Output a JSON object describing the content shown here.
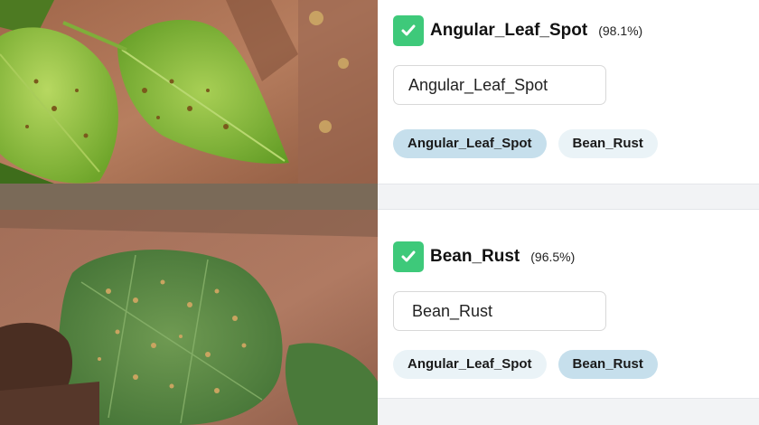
{
  "results": [
    {
      "title": "Angular_Leaf_Spot",
      "confidence": "(98.1%)",
      "input_value": "Angular_Leaf_Spot",
      "tags": [
        "Angular_Leaf_Spot",
        "Bean_Rust"
      ],
      "selected_tag": 0,
      "image_alt": "bean leaves with angular leaf spot on soil"
    },
    {
      "title": "Bean_Rust",
      "confidence": "(96.5%)",
      "input_value": "Bean_Rust",
      "tags": [
        "Angular_Leaf_Spot",
        "Bean_Rust"
      ],
      "selected_tag": 1,
      "image_alt": "hand holding bean leaf with rust spots"
    }
  ],
  "colors": {
    "check": "#3ec97a",
    "tag_selected": "#c6dfec",
    "tag_unselected": "#eaf3f7"
  }
}
